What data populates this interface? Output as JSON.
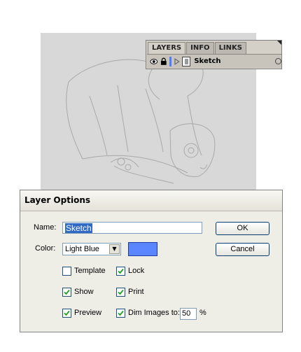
{
  "layers_panel": {
    "tabs": [
      {
        "label": "LAYERS"
      },
      {
        "label": "INFO"
      },
      {
        "label": "LINKS"
      }
    ],
    "layer": {
      "name": "Sketch",
      "color": "#4f7dff",
      "visible": true,
      "locked": true
    }
  },
  "dialog": {
    "title": "Layer Options",
    "name_label": "Name:",
    "name_value": "Sketch",
    "color_label": "Color:",
    "color_value": "Light Blue",
    "swatch_color": "#5a86ff",
    "ok_label": "OK",
    "cancel_label": "Cancel",
    "options": {
      "template": {
        "label": "Template",
        "checked": false
      },
      "lock": {
        "label": "Lock",
        "checked": true
      },
      "show": {
        "label": "Show",
        "checked": true
      },
      "print": {
        "label": "Print",
        "checked": true
      },
      "preview": {
        "label": "Preview",
        "checked": true
      },
      "dim": {
        "label": "Dim Images to:",
        "checked": true,
        "value": "50",
        "unit": "%"
      }
    }
  }
}
